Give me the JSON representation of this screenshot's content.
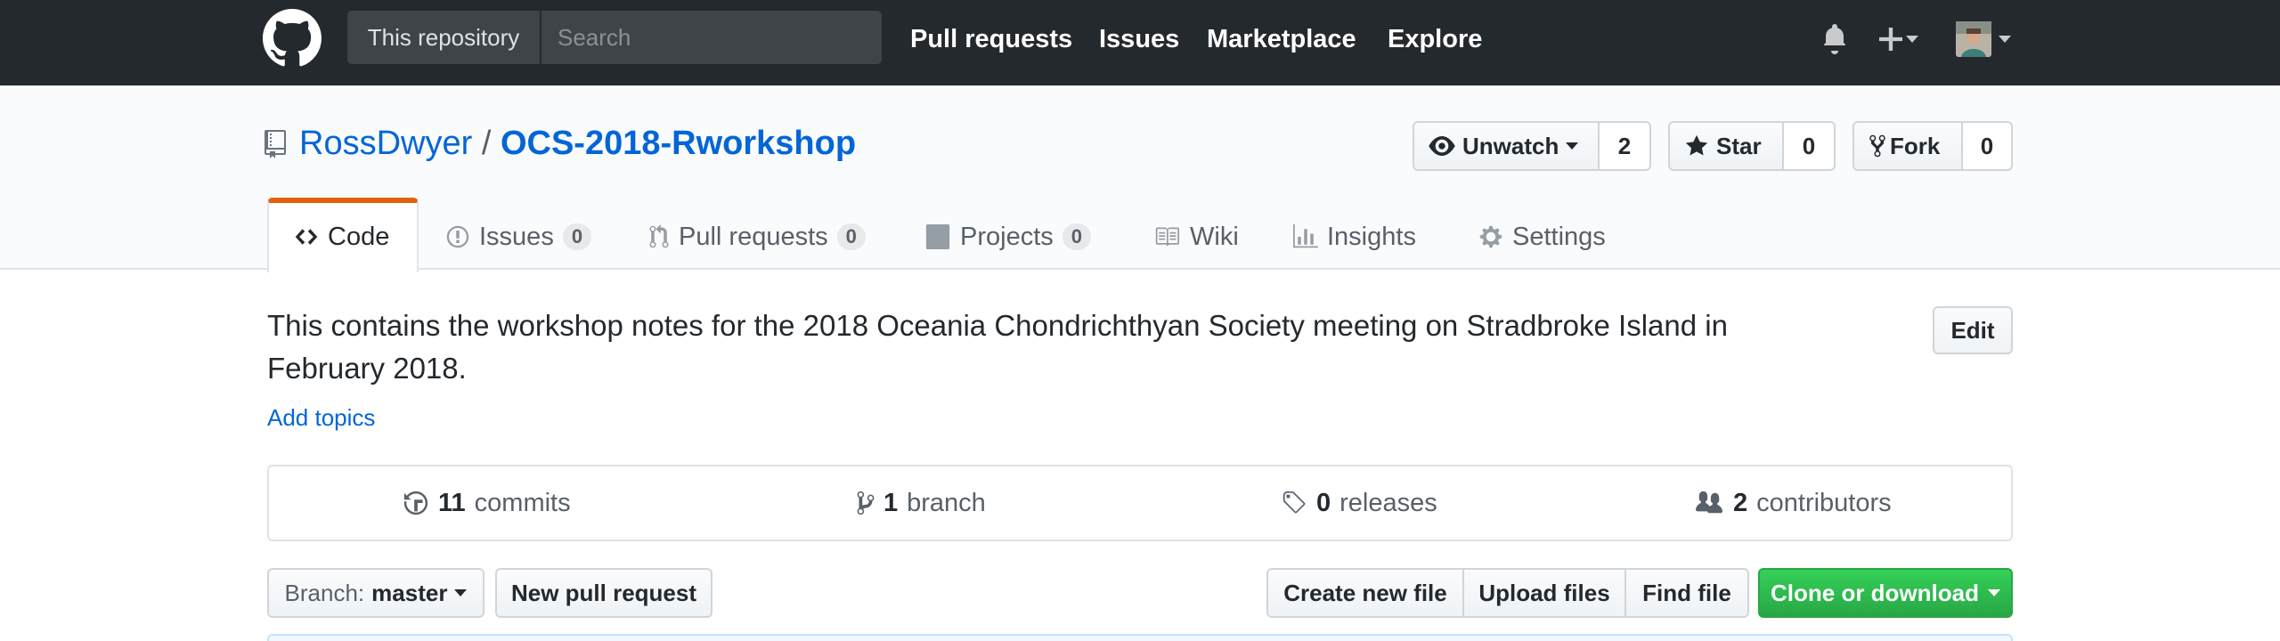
{
  "header": {
    "search_scope": "This repository",
    "search_placeholder": "Search",
    "nav": [
      "Pull requests",
      "Issues",
      "Marketplace",
      "Explore"
    ]
  },
  "repo": {
    "owner": "RossDwyer",
    "separator": "/",
    "name": "OCS-2018-Rworkshop"
  },
  "actions": {
    "watch": {
      "label": "Unwatch",
      "count": "2"
    },
    "star": {
      "label": "Star",
      "count": "0"
    },
    "fork": {
      "label": "Fork",
      "count": "0"
    }
  },
  "tabs": [
    {
      "label": "Code",
      "selected": true
    },
    {
      "label": "Issues",
      "count": "0"
    },
    {
      "label": "Pull requests",
      "count": "0"
    },
    {
      "label": "Projects",
      "count": "0"
    },
    {
      "label": "Wiki"
    },
    {
      "label": "Insights"
    },
    {
      "label": "Settings"
    }
  ],
  "description": {
    "line1": "This contains the workshop notes for the 2018 Oceania Chondrichthyan Society meeting on Stradbroke Island in",
    "line2": "February 2018.",
    "add_topics": "Add topics",
    "edit": "Edit"
  },
  "summary": {
    "commits": {
      "num": "11",
      "label": "commits"
    },
    "branch": {
      "num": "1",
      "label": "branch"
    },
    "releases": {
      "num": "0",
      "label": "releases"
    },
    "contributors": {
      "num": "2",
      "label": "contributors"
    }
  },
  "file_nav": {
    "branch_prefix": "Branch:",
    "branch_name": "master",
    "new_pull_request": "New pull request",
    "create_new_file": "Create new file",
    "upload_files": "Upload files",
    "find_file": "Find file",
    "clone_or_download": "Clone or download"
  },
  "colors": {
    "header_bg": "#24292e",
    "link": "#0366d6",
    "selected_tab_accent": "#e36209",
    "primary_button": "#28a745"
  }
}
